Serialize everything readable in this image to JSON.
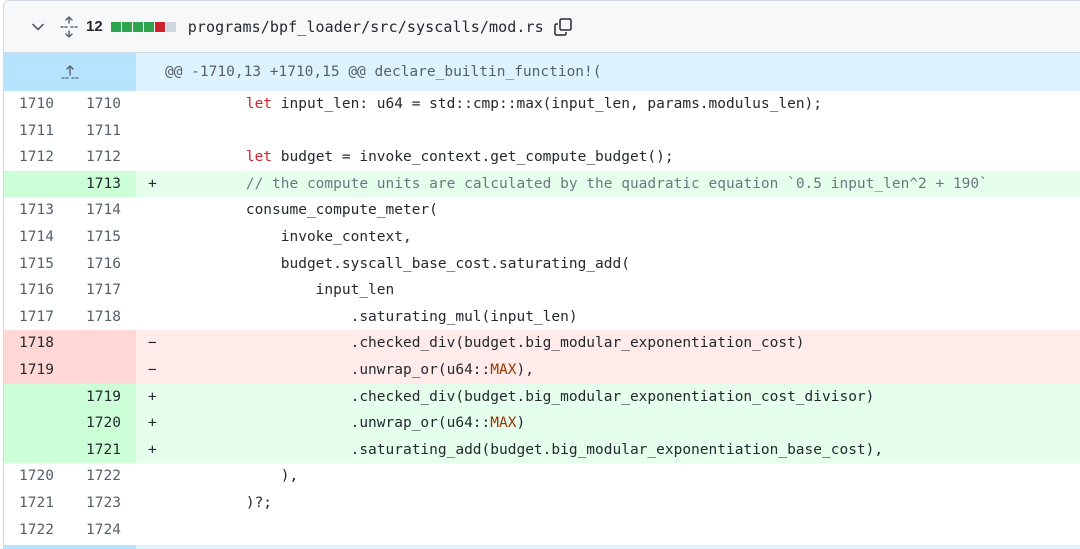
{
  "file_header": {
    "change_count": "12",
    "diffstat_colors": [
      "#2da44e",
      "#2da44e",
      "#2da44e",
      "#2da44e",
      "#cf222e",
      "#d0d7de"
    ],
    "path": "programs/bpf_loader/src/syscalls/mod.rs",
    "icons": {
      "collapse": "chevron-down-icon",
      "expand": "expand-all-icon",
      "copy": "copy-icon"
    }
  },
  "hunk": {
    "header": "@@ -1710,13 +1710,15 @@ declare_builtin_function!(",
    "expand_icon": "expand-up-icon"
  },
  "colors": {
    "added_bg": "#e6ffec",
    "added_num_bg": "#ccffd8",
    "deleted_bg": "#ffebe9",
    "deleted_num_bg": "#ffd7d5",
    "hunk_bg": "#ddf4ff",
    "keyword": "#cf222e",
    "comment": "#6e7781",
    "constant": "#953800"
  },
  "lines": [
    {
      "type": "ctx",
      "old": "1710",
      "new": "1710",
      "sign": "",
      "parts": [
        {
          "t": "        "
        },
        {
          "t": "let",
          "c": "kw"
        },
        {
          "t": " input_len: u64 = std::cmp::max(input_len, params.modulus_len);"
        }
      ]
    },
    {
      "type": "ctx",
      "old": "1711",
      "new": "1711",
      "sign": "",
      "parts": [
        {
          "t": ""
        }
      ]
    },
    {
      "type": "ctx",
      "old": "1712",
      "new": "1712",
      "sign": "",
      "parts": [
        {
          "t": "        "
        },
        {
          "t": "let",
          "c": "kw"
        },
        {
          "t": " budget = invoke_context.get_compute_budget();"
        }
      ]
    },
    {
      "type": "add",
      "old": "",
      "new": "1713",
      "sign": "+",
      "parts": [
        {
          "t": "        "
        },
        {
          "t": "// the compute units are calculated by the quadratic equation `0.5 input_len^2 + 190`",
          "c": "cm"
        }
      ]
    },
    {
      "type": "ctx",
      "old": "1713",
      "new": "1714",
      "sign": "",
      "parts": [
        {
          "t": "        consume_compute_meter("
        }
      ]
    },
    {
      "type": "ctx",
      "old": "1714",
      "new": "1715",
      "sign": "",
      "parts": [
        {
          "t": "            invoke_context,"
        }
      ]
    },
    {
      "type": "ctx",
      "old": "1715",
      "new": "1716",
      "sign": "",
      "parts": [
        {
          "t": "            budget.syscall_base_cost.saturating_add("
        }
      ]
    },
    {
      "type": "ctx",
      "old": "1716",
      "new": "1717",
      "sign": "",
      "parts": [
        {
          "t": "                input_len"
        }
      ]
    },
    {
      "type": "ctx",
      "old": "1717",
      "new": "1718",
      "sign": "",
      "parts": [
        {
          "t": "                    .saturating_mul(input_len)"
        }
      ]
    },
    {
      "type": "del",
      "old": "1718",
      "new": "",
      "sign": "−",
      "parts": [
        {
          "t": "                    .checked_div(budget.big_modular_exponentiation_cost)"
        }
      ]
    },
    {
      "type": "del",
      "old": "1719",
      "new": "",
      "sign": "−",
      "parts": [
        {
          "t": "                    .unwrap_or(u64::"
        },
        {
          "t": "MAX",
          "c": "const"
        },
        {
          "t": "),"
        }
      ]
    },
    {
      "type": "add",
      "old": "",
      "new": "1719",
      "sign": "+",
      "parts": [
        {
          "t": "                    .checked_div(budget.big_modular_exponentiation_cost_divisor)"
        }
      ]
    },
    {
      "type": "add",
      "old": "",
      "new": "1720",
      "sign": "+",
      "parts": [
        {
          "t": "                    .unwrap_or(u64::"
        },
        {
          "t": "MAX",
          "c": "const"
        },
        {
          "t": ")"
        }
      ]
    },
    {
      "type": "add",
      "old": "",
      "new": "1721",
      "sign": "+",
      "parts": [
        {
          "t": "                    .saturating_add(budget.big_modular_exponentiation_base_cost),"
        }
      ]
    },
    {
      "type": "ctx",
      "old": "1720",
      "new": "1722",
      "sign": "",
      "parts": [
        {
          "t": "            ),"
        }
      ]
    },
    {
      "type": "ctx",
      "old": "1721",
      "new": "1723",
      "sign": "",
      "parts": [
        {
          "t": "        )?;"
        }
      ]
    },
    {
      "type": "ctx",
      "old": "1722",
      "new": "1724",
      "sign": "",
      "parts": [
        {
          "t": ""
        }
      ]
    }
  ]
}
